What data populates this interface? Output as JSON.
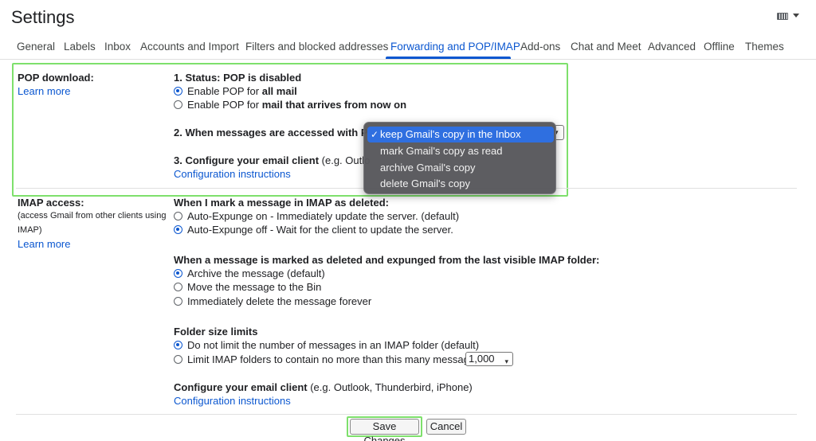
{
  "header": {
    "title": "Settings",
    "keyboard_icon": "keyboard-icon"
  },
  "tabs": [
    {
      "label": "General"
    },
    {
      "label": "Labels"
    },
    {
      "label": "Inbox"
    },
    {
      "label": "Accounts and Import"
    },
    {
      "label": "Filters and blocked addresses"
    },
    {
      "label": "Forwarding and POP/IMAP",
      "active": true
    },
    {
      "label": "Add-ons"
    },
    {
      "label": "Chat and Meet"
    },
    {
      "label": "Advanced"
    },
    {
      "label": "Offline"
    },
    {
      "label": "Themes"
    }
  ],
  "pop": {
    "heading": "POP download:",
    "learn_more": "Learn more",
    "status": "1. Status: POP is disabled",
    "opt1_prefix": "Enable POP for ",
    "opt1_bold": "all mail",
    "opt2_prefix": "Enable POP for ",
    "opt2_bold": "mail that arrives from now on",
    "when_accessed": "2. When messages are accessed with PO",
    "configure_bold": "3. Configure your email client",
    "configure_rest": " (e.g. Outlo",
    "config_link": "Configuration instructions"
  },
  "dropdown": {
    "options": [
      {
        "label": "keep Gmail's copy in the Inbox",
        "selected": true
      },
      {
        "label": "mark Gmail's copy as read"
      },
      {
        "label": "archive Gmail's copy"
      },
      {
        "label": "delete Gmail's copy"
      }
    ],
    "check": "✓"
  },
  "imap": {
    "heading": "IMAP access:",
    "sub1": "(access Gmail from other clients using",
    "sub2": "IMAP)",
    "learn_more": "Learn more",
    "mark_deleted_heading": "When I mark a message in IMAP as deleted:",
    "auto_on": "Auto-Expunge on - Immediately update the server. (default)",
    "auto_off": "Auto-Expunge off - Wait for the client to update the server.",
    "expunged_heading": "When a message is marked as deleted and expunged from the last visible IMAP folder:",
    "archive": "Archive the message (default)",
    "move_bin": "Move the message to the Bin",
    "delete_forever": "Immediately delete the message forever",
    "folder_heading": "Folder size limits",
    "no_limit": "Do not limit the number of messages in an IMAP folder (default)",
    "limit": "Limit IMAP folders to contain no more than this many messages",
    "limit_value": "1,000",
    "configure_bold": "Configure your email client",
    "configure_rest": " (e.g. Outlook, Thunderbird, iPhone)",
    "config_link": "Configuration instructions"
  },
  "footer": {
    "save": "Save Changes",
    "cancel": "Cancel"
  },
  "colors": {
    "accent": "#0b57d0",
    "highlight": "#7ee06c",
    "dropdown_bg": "#58585c",
    "dropdown_selected": "#2f6fe0"
  }
}
